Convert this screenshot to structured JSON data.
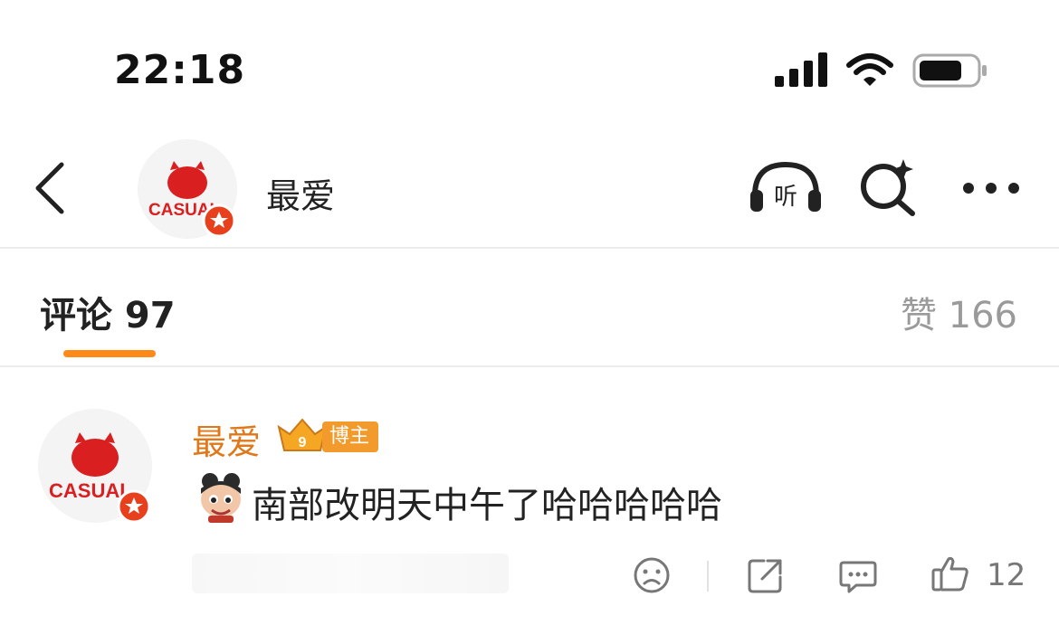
{
  "status_bar": {
    "time": "22:18"
  },
  "header": {
    "avatar_label": "CASUAL",
    "name": "最爱",
    "listen_label": "听"
  },
  "tabs": {
    "comments_label": "评论 97",
    "likes_label": "赞 166"
  },
  "comment": {
    "avatar_label": "CASUAL",
    "author": "最爱",
    "level": "9",
    "badge": "博主",
    "text": "南部改明天中午了哈哈哈哈哈",
    "like_count": "12"
  },
  "colors": {
    "accent": "#ff8a1a",
    "author": "#e0781a",
    "badge": "#f39a2c",
    "avatar_red": "#d91f1f"
  }
}
